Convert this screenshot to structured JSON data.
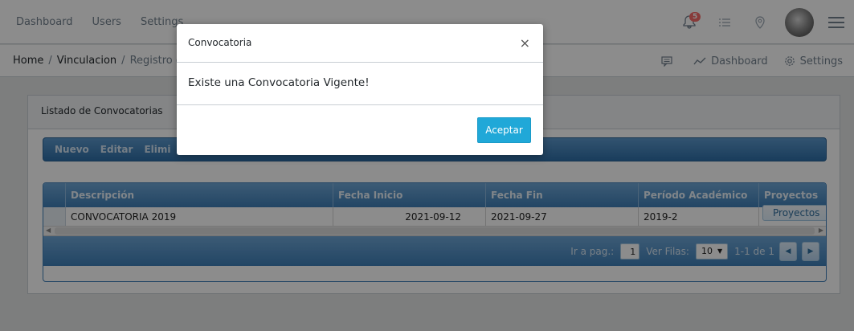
{
  "header": {
    "nav": [
      "Dashboard",
      "Users",
      "Settings"
    ],
    "notification_count": "5",
    "icons": [
      "bell-icon",
      "list-icon",
      "location-pin-icon",
      "avatar",
      "menu-icon"
    ]
  },
  "breadcrumb": {
    "items": [
      "Home",
      "Vinculacion",
      "Registro de"
    ],
    "right": {
      "chat_icon": "speech-bubble-icon",
      "dashboard_label": "Dashboard",
      "settings_label": "Settings"
    }
  },
  "card": {
    "title": "Listado de Convocatorias",
    "toolbar": [
      "Nuevo",
      "Editar",
      "Elimi"
    ]
  },
  "grid": {
    "columns": [
      "Descripción",
      "Fecha Inicio",
      "Fecha Fin",
      "Período Académico",
      "Proyectos"
    ],
    "rows": [
      {
        "descripcion": "CONVOCATORIA 2019",
        "fecha_inicio": "2021-09-12",
        "fecha_fin": "2021-09-27",
        "periodo": "2019-2",
        "proyectos_button": "Proyectos"
      }
    ],
    "pager": {
      "goto_label": "Ir a pag.:",
      "page_value": "1",
      "rows_label": "Ver Filas:",
      "rows_value": "10",
      "range_text": "1-1 de 1"
    }
  },
  "modal": {
    "title": "Convocatoria",
    "close_symbol": "×",
    "message": "Existe una Convocatoria Vigente!",
    "accept_label": "Aceptar"
  },
  "colors": {
    "accent": "#20a8d8",
    "badge": "#f86c6b",
    "grid_header": "#4f8ec6"
  }
}
